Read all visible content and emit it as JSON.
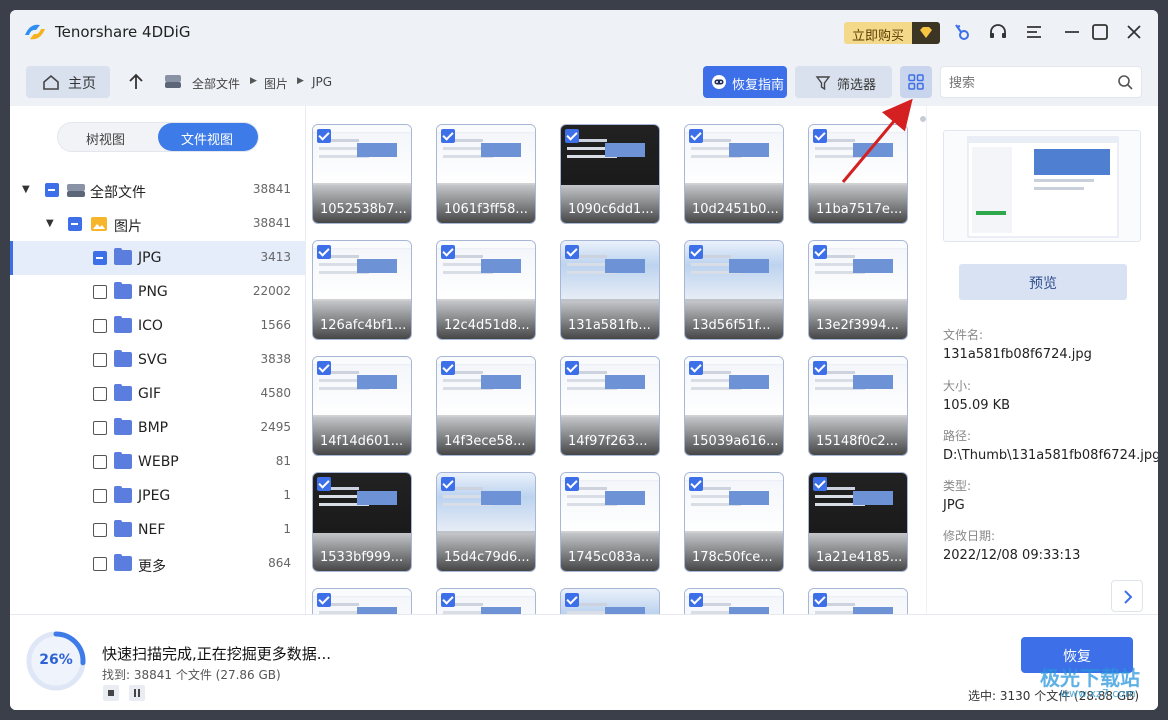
{
  "app": {
    "title": "Tenorshare 4DDiG",
    "buy_label": "立即购买"
  },
  "nav": {
    "home_label": "主页",
    "breadcrumb": [
      "全部文件",
      "图片",
      "JPG"
    ],
    "guide_label": "恢复指南",
    "filter_label": "筛选器",
    "search_placeholder": "搜索"
  },
  "sidebar": {
    "tree_view_label": "树视图",
    "file_view_label": "文件视图",
    "items": [
      {
        "label": "全部文件",
        "count": "38841"
      },
      {
        "label": "图片",
        "count": "38841"
      },
      {
        "label": "JPG",
        "count": "3413"
      },
      {
        "label": "PNG",
        "count": "22002"
      },
      {
        "label": "ICO",
        "count": "1566"
      },
      {
        "label": "SVG",
        "count": "3838"
      },
      {
        "label": "GIF",
        "count": "4580"
      },
      {
        "label": "BMP",
        "count": "2495"
      },
      {
        "label": "WEBP",
        "count": "81"
      },
      {
        "label": "JPEG",
        "count": "1"
      },
      {
        "label": "NEF",
        "count": "1"
      },
      {
        "label": "更多",
        "count": "864"
      }
    ]
  },
  "files": [
    "1052538b7...",
    "1061f3ff58...",
    "1090c6dd1...",
    "10d2451b0...",
    "11ba7517e...",
    "126afc4bf1...",
    "12c4d51d8...",
    "131a581fb...",
    "13d56f51f...",
    "13e2f3994...",
    "14f14d601...",
    "14f3ece58...",
    "14f97f263...",
    "15039a616...",
    "15148f0c2...",
    "1533bf999...",
    "15d4c79d6...",
    "1745c083a...",
    "178c50fce...",
    "1a21e4185...",
    "",
    "",
    "",
    "",
    ""
  ],
  "details": {
    "preview_label": "预览",
    "filename_label": "文件名:",
    "filename": "131a581fb08f6724.jpg",
    "size_label": "大小:",
    "size": "105.09 KB",
    "path_label": "路径:",
    "path": "D:\\Thumb\\131a581fb08f6724.jpg",
    "type_label": "类型:",
    "type": "JPG",
    "modified_label": "修改日期:",
    "modified": "2022/12/08 09:33:13"
  },
  "status": {
    "progress_percent": "26%",
    "progress_value": 0.26,
    "message": "快速扫描完成,正在挖掘更多数据...",
    "found": "找到: 38841 个文件 (27.86 GB)",
    "recover_label": "恢复",
    "selected": "选中: 3130 个文件 (28.88 GB)"
  },
  "watermark": {
    "text": "极光下载站",
    "url": "www.xz7.com"
  },
  "colors": {
    "accent": "#3d6fe8",
    "selected_row": "#e5ecfa"
  }
}
